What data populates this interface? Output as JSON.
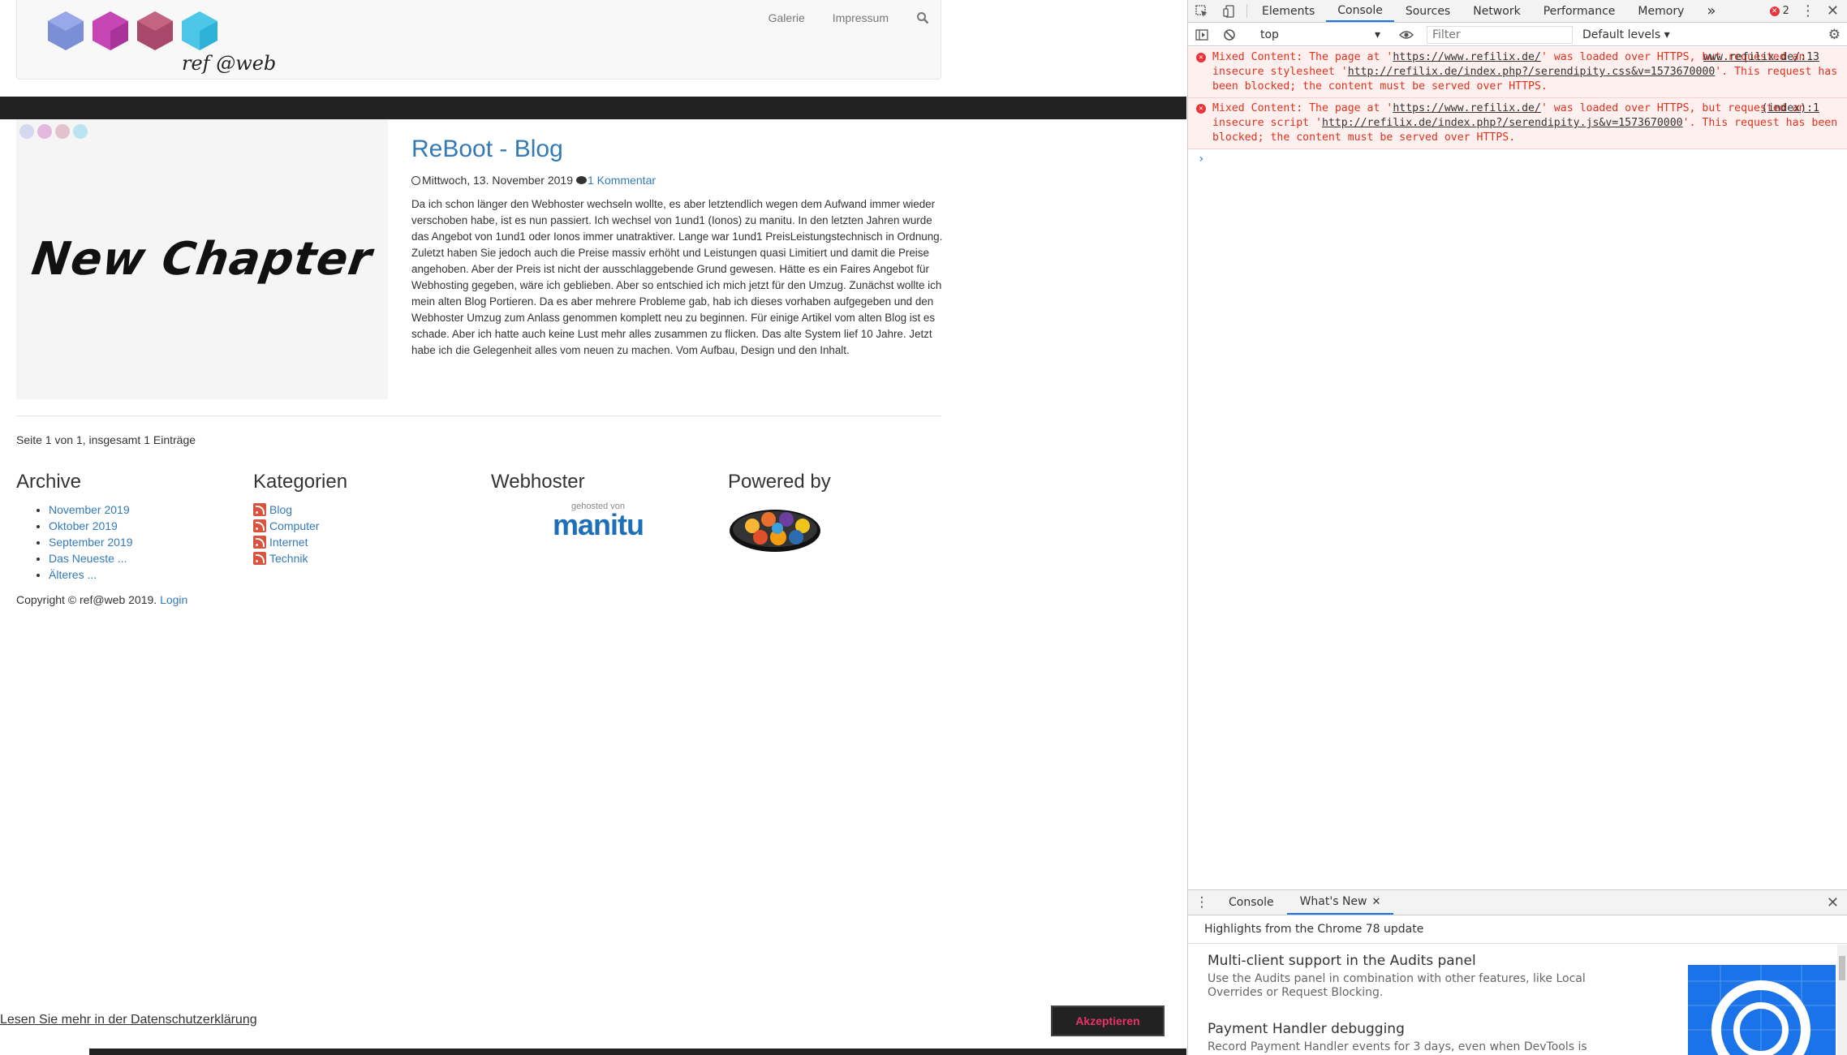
{
  "site": {
    "nav": {
      "gallery": "Galerie",
      "imprint": "Impressum",
      "search_icon": "search-icon"
    },
    "post": {
      "image_text": "New Chapter",
      "title": "ReBoot - Blog",
      "date": "Mittwoch, 13. November 2019",
      "comments": "1 Kommentar",
      "body": "Da ich schon länger den Webhoster wechseln wollte, es aber letztendlich wegen dem Aufwand immer wieder verschoben habe, ist es nun passiert. Ich wechsel von 1und1 (Ionos) zu manitu. In den letzten Jahren wurde das Angebot von 1und1 oder Ionos immer unatraktiver. Lange war 1und1 PreisLeistungstechnisch in Ordnung. Zuletzt haben Sie jedoch auch die Preise massiv erhöht und Leistungen quasi Limitiert und damit die Preise angehoben. Aber der Preis ist nicht der ausschlaggebende Grund gewesen. Hätte es ein Faires Angebot für Webhosting gegeben, wäre ich geblieben. Aber so entschied ich mich jetzt für den Umzug. Zunächst wollte ich mein alten Blog Portieren. Da es aber mehrere Probleme gab, hab ich dieses vorhaben aufgegeben und den Webhoster Umzug zum Anlass genommen komplett neu zu beginnen. Für einige Artikel vom alten Blog ist es schade. Aber ich hatte auch keine Lust mehr alles zusammen zu flicken. Das alte System lief 10 Jahre. Jetzt habe ich die Gelegenheit alles vom neuen zu machen. Vom Aufbau, Design und den Inhalt."
    },
    "pagination": "Seite 1 von 1, insgesamt 1 Einträge",
    "archive": {
      "title": "Archive",
      "items": [
        "November 2019",
        "Oktober 2019",
        "September 2019",
        "Das Neueste ...",
        "Älteres ..."
      ]
    },
    "categories": {
      "title": "Kategorien",
      "items": [
        "Blog",
        "Computer",
        "Internet",
        "Technik"
      ]
    },
    "webhoster": {
      "title": "Webhoster",
      "badge_small": "gehosted von",
      "badge_big": "manitu"
    },
    "powered": {
      "title": "Powered by"
    },
    "copyright": "Copyright © ref@web 2019.",
    "login": "Login",
    "cookie": {
      "link": "Lesen Sie mehr in der Datenschutzerklärung",
      "accept": "Akzeptieren"
    }
  },
  "devtools": {
    "tabs": [
      "Elements",
      "Console",
      "Sources",
      "Network",
      "Performance",
      "Memory"
    ],
    "more_tabs": "»",
    "error_count": "2",
    "context": "top",
    "filter_placeholder": "Filter",
    "levels": "Default levels ▾",
    "messages": [
      {
        "pre": "Mixed Content: The page at '",
        "page_url": "https://www.refilix.de/",
        "mid": "' was loaded over HTTPS, but requested an insecure stylesheet '",
        "res_url": "http://refilix.de/index.php?/serendipity.css&v=1573670000",
        "post": "'. This request has been blocked; the content must be served over HTTPS.",
        "source": "www.refilix.de/:13"
      },
      {
        "pre": "Mixed Content: The page at '",
        "page_url": "https://www.refilix.de/",
        "mid": "' was loaded over HTTPS, but requested an insecure script '",
        "res_url": "http://refilix.de/index.php?/serendipity.js&v=1573670000",
        "post": "'. This request has been blocked; the content must be served over HTTPS.",
        "source": "(index):1"
      }
    ],
    "prompt": "›",
    "drawer_tabs": [
      "Console",
      "What's New"
    ],
    "highlights": "Highlights from the Chrome 78 update",
    "whatsnew": [
      {
        "title": "Multi-client support in the Audits panel",
        "desc": "Use the Audits panel in combination with other features, like Local Overrides or Request Blocking."
      },
      {
        "title": "Payment Handler debugging",
        "desc": "Record Payment Handler events for 3 days, even when DevTools is closed."
      }
    ]
  },
  "colors": {
    "link": "#337ab7",
    "error": "#e0311c",
    "accent": "#1a73e8",
    "cookie_button_text": "#e8336a"
  }
}
